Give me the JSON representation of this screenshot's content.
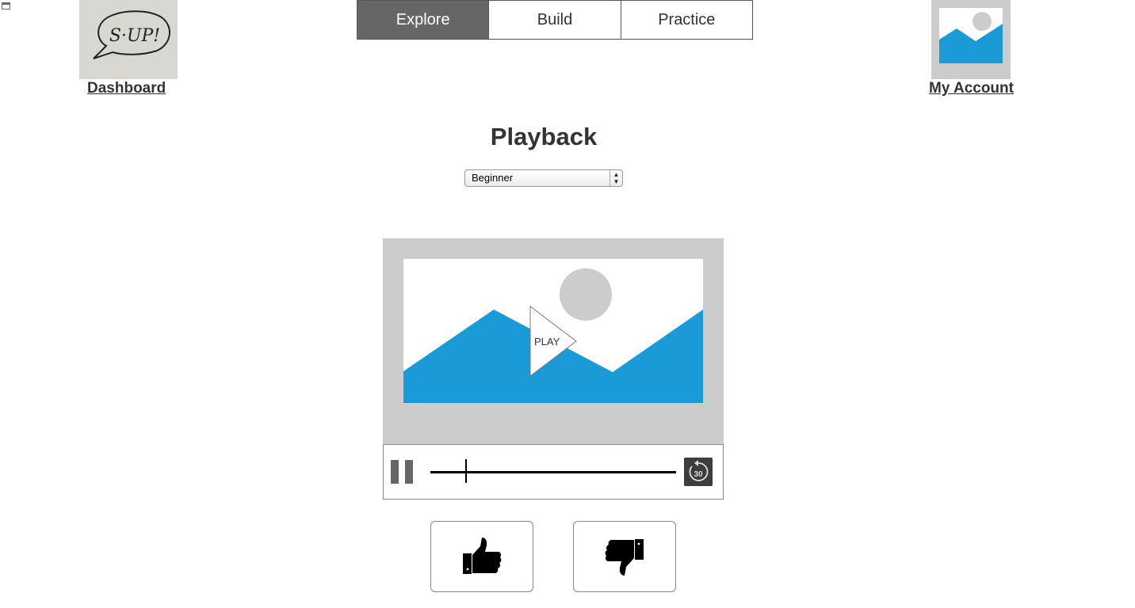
{
  "header": {
    "dashboard_label": "Dashboard",
    "logo_text": "S·UP!",
    "account_label": "My Account"
  },
  "tabs": [
    {
      "label": "Explore",
      "active": true
    },
    {
      "label": "Build",
      "active": false
    },
    {
      "label": "Practice",
      "active": false
    }
  ],
  "page": {
    "title": "Playback"
  },
  "level_select": {
    "value": "Beginner"
  },
  "player": {
    "play_label": "PLAY",
    "rewind_label": "30",
    "progress": 0.145,
    "colors": {
      "mountain": "#1a9ad6",
      "sun": "#cccccc",
      "frame": "#cccccc"
    }
  },
  "feedback": {
    "up_icon": "thumbs-up-icon",
    "down_icon": "thumbs-down-icon"
  }
}
